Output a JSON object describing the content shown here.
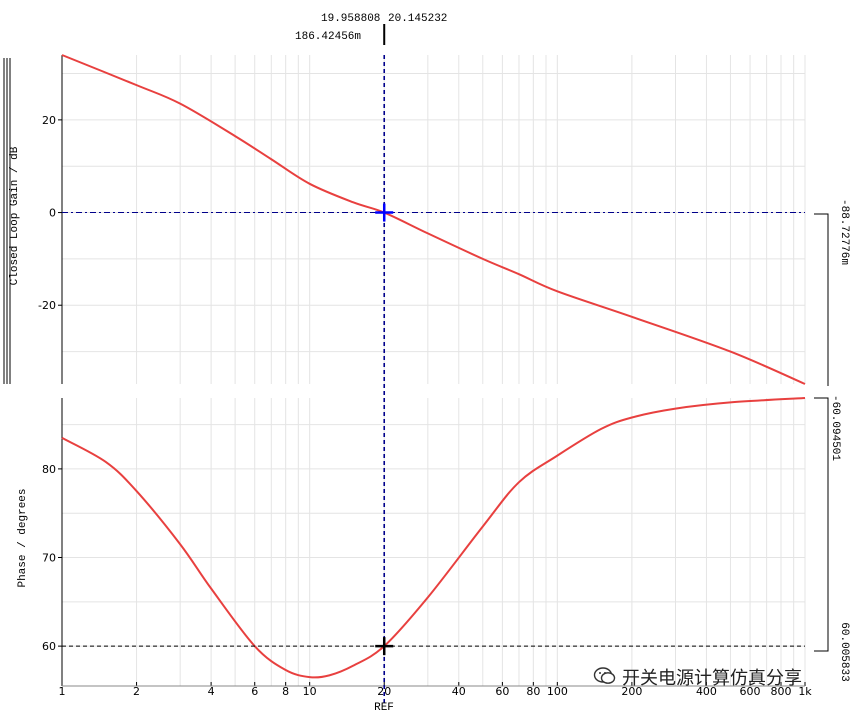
{
  "cursor": {
    "readout_x": "19.958808",
    "readout_y": "20.145232",
    "readout_dx": "186.42456m",
    "right_gain": "-88.72776m",
    "right_phase_top": "-60.094501",
    "right_phase_bottom": "60.005833"
  },
  "watermark": {
    "text": "开关电源计算仿真分享",
    "icon": "wechat-icon"
  },
  "colors": {
    "curve": "#e8403f",
    "cursor": "#00008b",
    "grid": "#e4e4e4"
  },
  "chart_data": [
    {
      "type": "line",
      "title": "",
      "xlabel": "REF",
      "ylabel": "Closed Loop Gain / dB",
      "xscale": "log",
      "xlim": [
        1,
        1000
      ],
      "ylim": [
        -37,
        34
      ],
      "yticks": [
        20,
        0,
        -20
      ],
      "grid": true,
      "series": [
        {
          "x": [
            1,
            2,
            3,
            5,
            7,
            10,
            15,
            20,
            30,
            50,
            70,
            100,
            200,
            500,
            1000
          ],
          "y": [
            34,
            27.5,
            23.5,
            16.5,
            11.5,
            6.2,
            2.2,
            0,
            -4.5,
            -10,
            -13.3,
            -17,
            -22.5,
            -30,
            -37
          ]
        }
      ]
    },
    {
      "type": "line",
      "title": "",
      "xlabel": "REF",
      "ylabel": "Phase / degrees",
      "xscale": "log",
      "xlim": [
        1,
        1000
      ],
      "ylim": [
        55.5,
        88
      ],
      "yticks": [
        80,
        70,
        60
      ],
      "xticks": [
        "1",
        "2",
        "4",
        "6",
        "8",
        "10",
        "20",
        "40",
        "60",
        "80",
        "100",
        "200",
        "400",
        "600",
        "800",
        "1k"
      ],
      "grid": true,
      "series": [
        {
          "x": [
            1,
            1.5,
            2,
            3,
            4,
            6,
            8,
            10,
            12,
            15,
            20,
            30,
            50,
            70,
            100,
            150,
            200,
            300,
            500,
            1000
          ],
          "y": [
            83.5,
            80.8,
            77.5,
            71.5,
            66.5,
            60,
            57.3,
            56.5,
            56.7,
            57.8,
            60,
            65.5,
            73.5,
            78.5,
            81.5,
            84.5,
            85.8,
            86.8,
            87.5,
            88
          ]
        }
      ]
    }
  ]
}
